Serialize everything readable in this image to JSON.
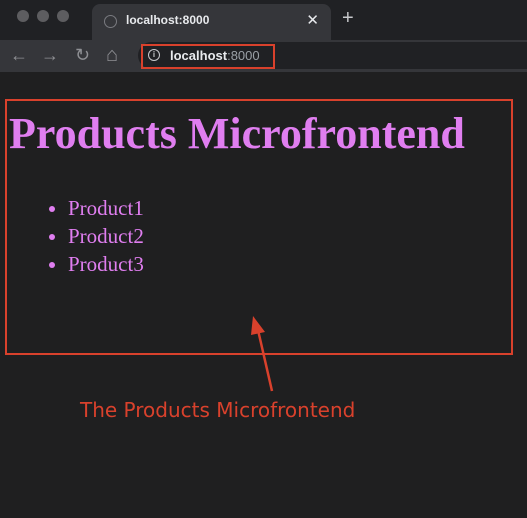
{
  "browser": {
    "tab": {
      "title": "localhost:8000",
      "close_glyph": "✕"
    },
    "new_tab_glyph": "+",
    "nav": {
      "back_glyph": "←",
      "forward_glyph": "→",
      "reload_glyph": "↻",
      "home_glyph": "⌂"
    },
    "address_bar": {
      "host": "localhost",
      "port": ":8000",
      "info_glyph": "i"
    }
  },
  "page": {
    "heading": "Products Microfrontend",
    "products": [
      "Product1",
      "Product2",
      "Product3"
    ]
  },
  "annotation": {
    "label": "The Products Microfrontend"
  },
  "colors": {
    "page_text": "#e07ef0",
    "annotation": "#d9412c",
    "background": "#1f1f20"
  },
  "icons": {
    "back": "arrow-left-icon",
    "forward": "arrow-right-icon",
    "reload": "reload-icon",
    "home": "home-icon",
    "site_info": "info-icon",
    "tab_favicon": "globe-icon",
    "close": "close-icon",
    "new_tab": "plus-icon"
  }
}
